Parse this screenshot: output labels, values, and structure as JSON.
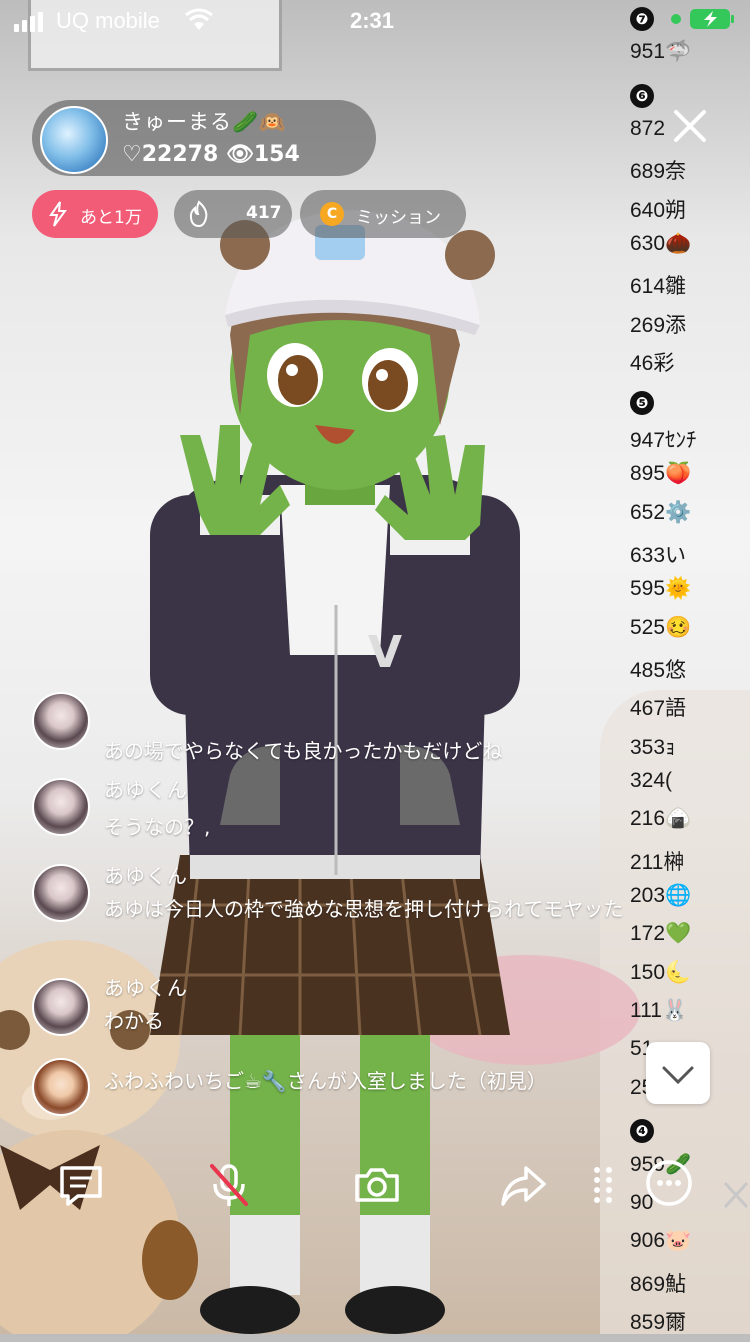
{
  "status_bar": {
    "carrier": "UQ mobile",
    "time": "2:31"
  },
  "streamer": {
    "name": "きゅーまる🥒🙉",
    "stats": "♡22278 👁154"
  },
  "badges": {
    "goal": "あと1万",
    "fire_count": "417",
    "mission": "ミッション",
    "coin_letter": "C"
  },
  "ranking": [
    {
      "type": "head",
      "label": "❼"
    },
    {
      "type": "row",
      "label": "951🦈"
    },
    {
      "type": "head",
      "label": "❻"
    },
    {
      "type": "row",
      "label": "872"
    },
    {
      "type": "row",
      "label": "689奈"
    },
    {
      "type": "row",
      "label": "640朔"
    },
    {
      "type": "row",
      "label": "630🌰"
    },
    {
      "type": "row",
      "label": "614雛"
    },
    {
      "type": "row",
      "label": "269添"
    },
    {
      "type": "row",
      "label": "46彩"
    },
    {
      "type": "head",
      "label": "❺"
    },
    {
      "type": "row",
      "label": "947ｾﾝﾁ"
    },
    {
      "type": "row",
      "label": "895🍑"
    },
    {
      "type": "row",
      "label": "652⚙️"
    },
    {
      "type": "row",
      "label": "633い"
    },
    {
      "type": "row",
      "label": "595🌞"
    },
    {
      "type": "row",
      "label": "525🥴"
    },
    {
      "type": "row",
      "label": "485悠"
    },
    {
      "type": "row",
      "label": "467語"
    },
    {
      "type": "row",
      "label": "353ｮ"
    },
    {
      "type": "row",
      "label": "324("
    },
    {
      "type": "row",
      "label": "216🍙"
    },
    {
      "type": "row",
      "label": "211榊"
    },
    {
      "type": "row",
      "label": "203🌐"
    },
    {
      "type": "row",
      "label": "172💚"
    },
    {
      "type": "row",
      "label": "150🌜"
    },
    {
      "type": "row",
      "label": "111🐰"
    },
    {
      "type": "row",
      "label": "51"
    },
    {
      "type": "row",
      "label": "25"
    },
    {
      "type": "head",
      "label": "❹"
    },
    {
      "type": "row",
      "label": "959🥒"
    },
    {
      "type": "row",
      "label": "90"
    },
    {
      "type": "row",
      "label": "906🐷"
    },
    {
      "type": "row",
      "label": "869鮎"
    },
    {
      "type": "row",
      "label": "859爾"
    }
  ],
  "comments": [
    {
      "user": "",
      "text": "あの場でやらなくても良かったかもだけどね"
    },
    {
      "user": "あゆくん",
      "text": "そうなの？,"
    },
    {
      "user": "あゆくん",
      "text": "あゆは今日人の枠で強めな思想を押し付けられてモヤッた"
    },
    {
      "user": "あゆくん",
      "text": "わかる"
    },
    {
      "user": "",
      "text": "ふわふわいちご☕🔧さんが入室しました（初見）"
    }
  ],
  "toolbar": {
    "icons": [
      "comment-icon",
      "mic-off-icon",
      "camera-icon",
      "share-icon",
      "drag-handle-icon",
      "more-icon"
    ]
  },
  "colors": {
    "goal_pill": "#f25c77",
    "dark_pill": "rgba(90,90,90,.55)",
    "coin": "#f7a823",
    "battery": "#34c759"
  }
}
